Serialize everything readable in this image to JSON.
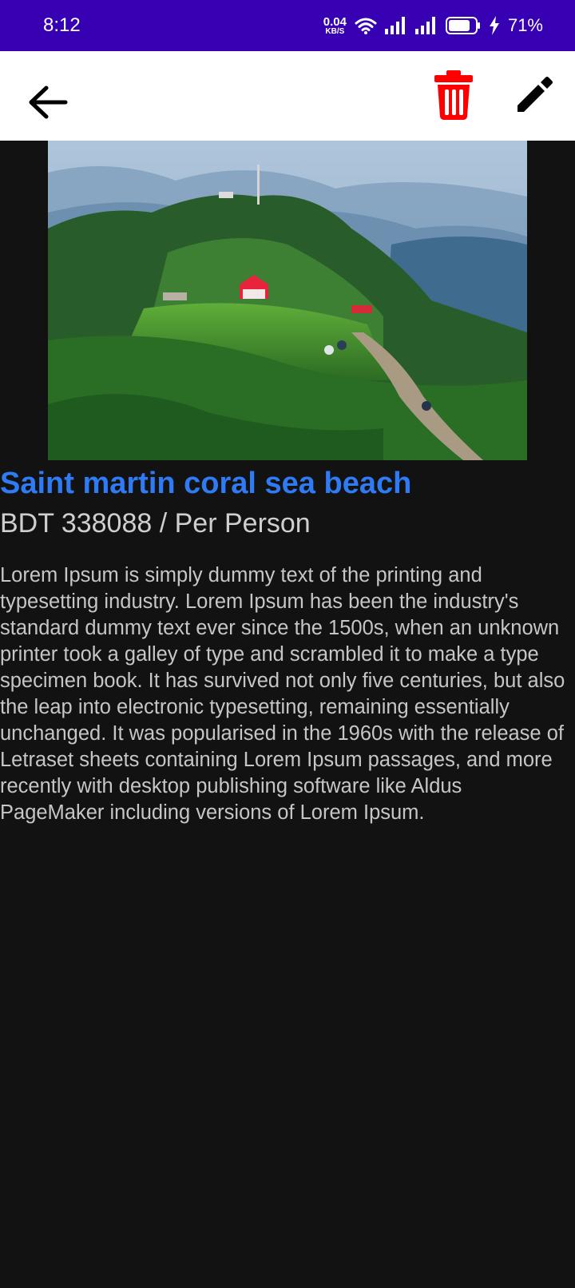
{
  "status_bar": {
    "time": "8:12",
    "net_speed_value": "0.04",
    "net_speed_unit": "KB/S",
    "battery_percent": "71%",
    "icons": [
      "wifi-icon",
      "signal-icon",
      "signal-icon",
      "battery-icon",
      "charging-icon"
    ]
  },
  "app_bar": {
    "icons": {
      "back": "arrow-left-icon",
      "delete": "trash-icon",
      "edit": "pencil-icon"
    },
    "colors": {
      "delete": "#ff0000",
      "edit": "#000000"
    }
  },
  "detail": {
    "title": "Saint martin coral sea beach",
    "price": "BDT 338088 / Per Person",
    "description": "Lorem Ipsum is simply dummy text of the printing and typesetting industry. Lorem Ipsum has been the industry's standard dummy text ever since the 1500s, when an unknown printer took a galley of type and scrambled it to make a type specimen book. It has survived not only five centuries, but also the leap into electronic typesetting, remaining essentially unchanged. It was popularised in the 1960s with the release of Letraset sheets containing Lorem Ipsum passages, and more recently with desktop publishing software like Aldus PageMaker including versions of Lorem Ipsum."
  },
  "colors": {
    "status_bar": "#3700b3",
    "background": "#121212",
    "title": "#2f7bf5",
    "text": "#c6c6c6"
  }
}
